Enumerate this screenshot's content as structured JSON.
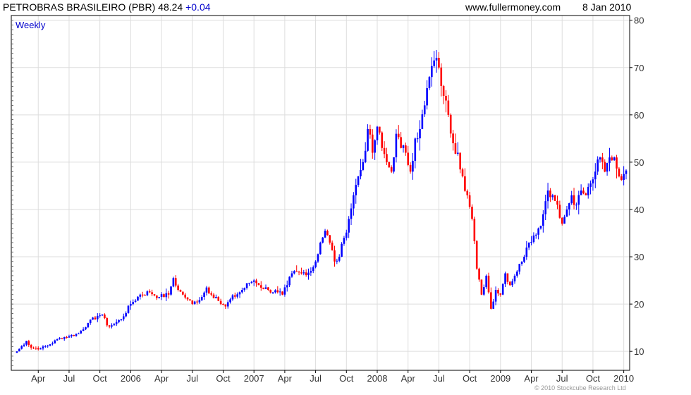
{
  "header": {
    "title": "PETROBRAS BRASILEIRO (PBR) 48.24",
    "change": "+0.04",
    "site": "www.fullermoney.com",
    "date": "8 Jan 2010"
  },
  "copyright": "© 2010 Stockcube Research Ltd",
  "colors": {
    "up": "#0000ff",
    "down": "#ff0000",
    "grid": "#dddddd",
    "frame": "#000000",
    "label": "#333333",
    "period_label": "#0000cc"
  },
  "chart_data": {
    "type": "candlestick",
    "period_label": "Weekly",
    "y_axis": {
      "position": "right",
      "ticks": [
        10,
        20,
        30,
        40,
        50,
        60,
        70,
        80
      ],
      "ylim": [
        6,
        81
      ]
    },
    "x_axis": {
      "tick_labels": [
        "Apr",
        "Jul",
        "Oct",
        "2006",
        "Apr",
        "Jul",
        "Oct",
        "2007",
        "Apr",
        "Jul",
        "Oct",
        "2008",
        "Apr",
        "Jul",
        "Oct",
        "2009",
        "Apr",
        "Jul",
        "Oct",
        "2010"
      ],
      "tick_weeks": [
        9,
        22,
        35,
        48,
        61,
        74,
        87,
        100,
        113,
        126,
        139,
        152,
        165,
        178,
        191,
        204,
        217,
        230,
        243,
        256
      ],
      "first_week": "Jan 2005",
      "last_week": "8 Jan 2010"
    },
    "series": {
      "name": "PBR",
      "anchors": [
        [
          0,
          10
        ],
        [
          4,
          12.2
        ],
        [
          6,
          10.8
        ],
        [
          10,
          10.6
        ],
        [
          14,
          11.5
        ],
        [
          18,
          12.8
        ],
        [
          22,
          13.2
        ],
        [
          26,
          13.8
        ],
        [
          30,
          16
        ],
        [
          34,
          17.5
        ],
        [
          36,
          17.8
        ],
        [
          38,
          15.5
        ],
        [
          40,
          15.5
        ],
        [
          44,
          16.8
        ],
        [
          48,
          20
        ],
        [
          52,
          22
        ],
        [
          56,
          22.5
        ],
        [
          60,
          21.5
        ],
        [
          64,
          22
        ],
        [
          66,
          25.5
        ],
        [
          68,
          23
        ],
        [
          70,
          22
        ],
        [
          72,
          21
        ],
        [
          74,
          20
        ],
        [
          78,
          21.5
        ],
        [
          80,
          23.5
        ],
        [
          82,
          22
        ],
        [
          84,
          21.5
        ],
        [
          86,
          20
        ],
        [
          88,
          19.5
        ],
        [
          90,
          21
        ],
        [
          94,
          22.5
        ],
        [
          98,
          24.5
        ],
        [
          100,
          25
        ],
        [
          102,
          24
        ],
        [
          106,
          23
        ],
        [
          110,
          22.5
        ],
        [
          112,
          22
        ],
        [
          114,
          24
        ],
        [
          116,
          26.5
        ],
        [
          120,
          26.5
        ],
        [
          124,
          27
        ],
        [
          126,
          29
        ],
        [
          128,
          33
        ],
        [
          130,
          35.5
        ],
        [
          132,
          33
        ],
        [
          134,
          29
        ],
        [
          136,
          30
        ],
        [
          138,
          34
        ],
        [
          140,
          38
        ],
        [
          142,
          43
        ],
        [
          144,
          47
        ],
        [
          146,
          50
        ],
        [
          148,
          57
        ],
        [
          150,
          52
        ],
        [
          152,
          57.5
        ],
        [
          154,
          53
        ],
        [
          156,
          50
        ],
        [
          158,
          48
        ],
        [
          160,
          56
        ],
        [
          162,
          53
        ],
        [
          164,
          52
        ],
        [
          166,
          48
        ],
        [
          168,
          55
        ],
        [
          170,
          57
        ],
        [
          172,
          62
        ],
        [
          174,
          68
        ],
        [
          176,
          71.5
        ],
        [
          178,
          70
        ],
        [
          180,
          64
        ],
        [
          182,
          60
        ],
        [
          184,
          54
        ],
        [
          186,
          52
        ],
        [
          188,
          47
        ],
        [
          190,
          43
        ],
        [
          192,
          38
        ],
        [
          194,
          27.5
        ],
        [
          196,
          22
        ],
        [
          198,
          26
        ],
        [
          200,
          19
        ],
        [
          202,
          23
        ],
        [
          204,
          22
        ],
        [
          206,
          26.5
        ],
        [
          208,
          24
        ],
        [
          210,
          26
        ],
        [
          212,
          28.5
        ],
        [
          214,
          30
        ],
        [
          216,
          33
        ],
        [
          218,
          34.5
        ],
        [
          220,
          36
        ],
        [
          222,
          39
        ],
        [
          224,
          44
        ],
        [
          226,
          43
        ],
        [
          228,
          41
        ],
        [
          230,
          37
        ],
        [
          232,
          40
        ],
        [
          234,
          43
        ],
        [
          236,
          41
        ],
        [
          238,
          44
        ],
        [
          240,
          43
        ],
        [
          242,
          45.5
        ],
        [
          244,
          48
        ],
        [
          246,
          51
        ],
        [
          248,
          48
        ],
        [
          250,
          51
        ],
        [
          252,
          51
        ],
        [
          254,
          47
        ],
        [
          256,
          47.5
        ],
        [
          257,
          48.24
        ]
      ],
      "last_close": 48.24
    }
  }
}
